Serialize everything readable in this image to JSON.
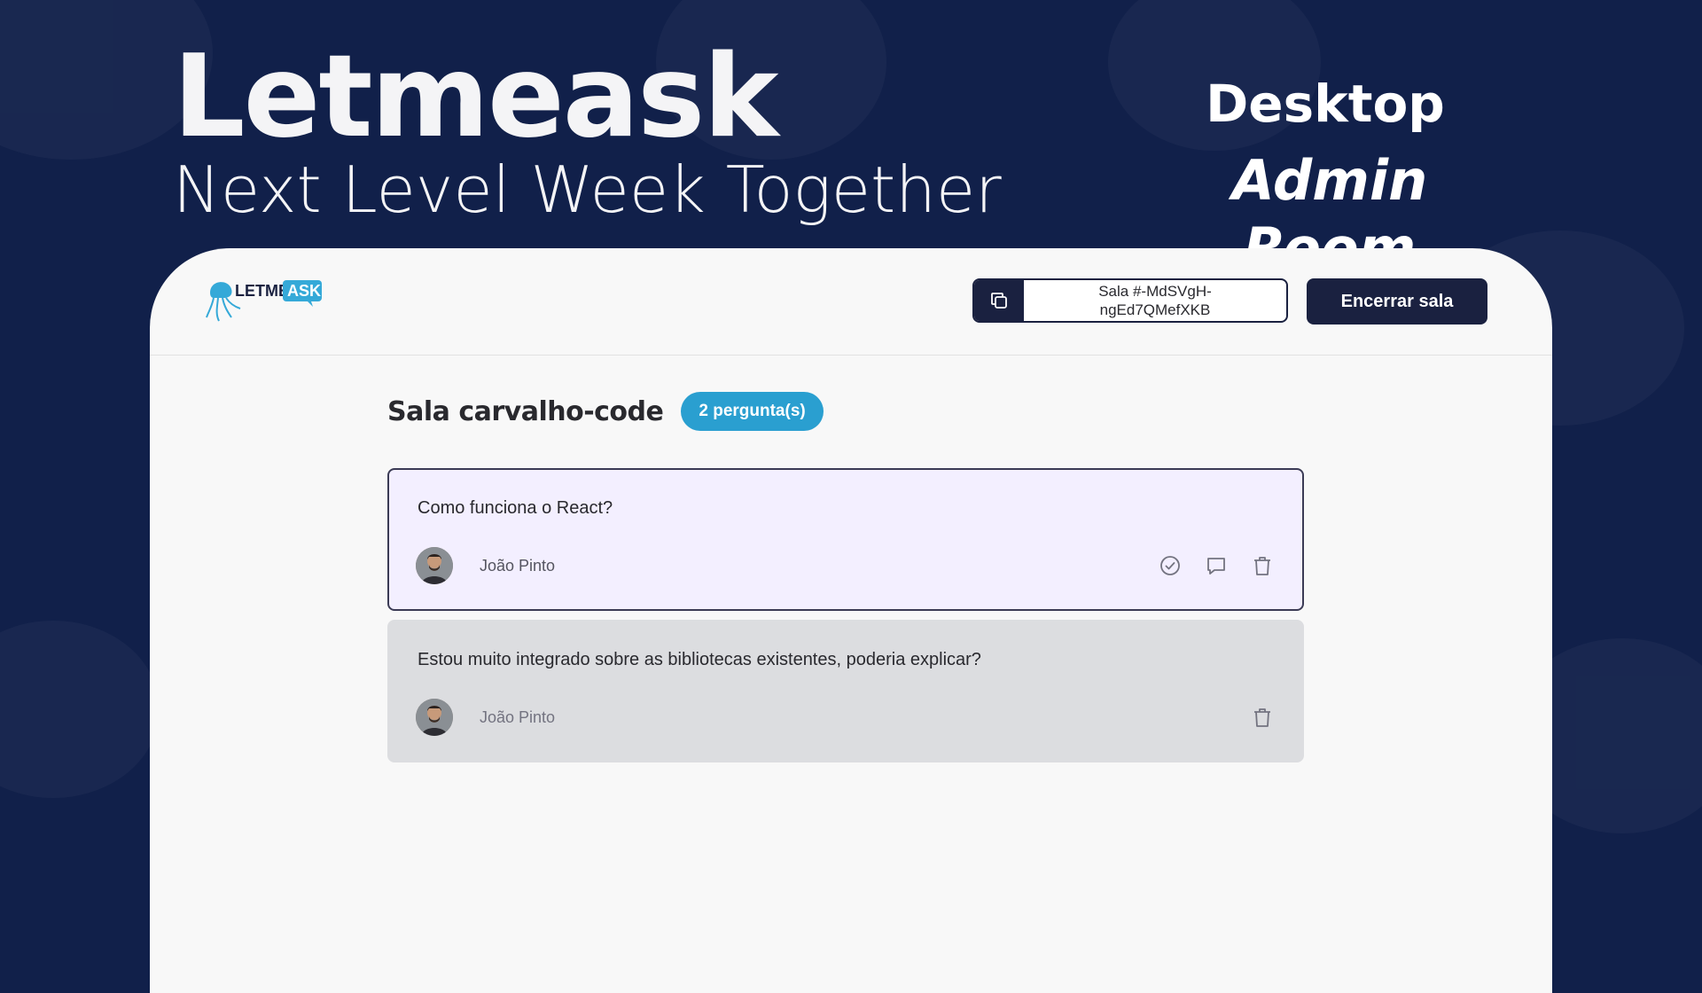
{
  "banner": {
    "title": "Letmeask",
    "subtitle": "Next Level Week Together",
    "platform": "Desktop",
    "screen": "Admin Room"
  },
  "header": {
    "logo_text_left": "LETME",
    "logo_text_right": "ASK",
    "room_code_text": "Sala #-MdSVgH-\nngEd7QMefXKB",
    "close_room_label": "Encerrar sala"
  },
  "room": {
    "title": "Sala carvalho-code",
    "question_count": "2 pergunta(s)"
  },
  "questions": [
    {
      "text": "Como funciona o React?",
      "author": "João Pinto",
      "state": "highlighted"
    },
    {
      "text": "Estou muito integrado sobre as bibliotecas existentes, poderia explicar?",
      "author": "João Pinto",
      "state": "answered"
    }
  ],
  "colors": {
    "background": "#11204a",
    "device": "#f8f8f8",
    "primary_dark": "#1a2140",
    "badge": "#2a9fd0",
    "highlight": "#f3efff",
    "answered": "#dcdde0"
  },
  "icons": {
    "copy": "copy-icon",
    "check": "check-circle-icon",
    "answer": "chat-bubble-icon",
    "delete": "trash-icon"
  }
}
